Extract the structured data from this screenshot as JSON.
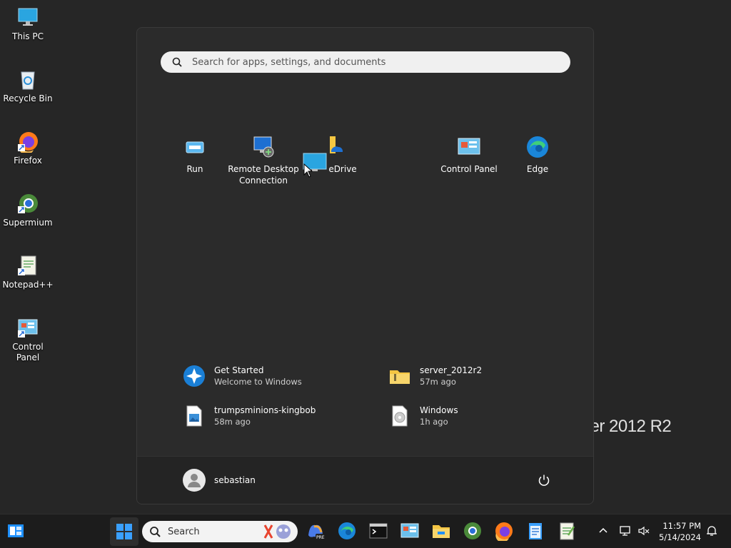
{
  "desktop": {
    "icons": [
      {
        "label": "This PC"
      },
      {
        "label": "Recycle Bin"
      },
      {
        "label": "Firefox"
      },
      {
        "label": "Supermium"
      },
      {
        "label": "Notepad++"
      },
      {
        "label": "Control Panel"
      }
    ],
    "watermark": "ver 2012 R2"
  },
  "start_menu": {
    "search": {
      "placeholder": "Search for apps, settings, and documents"
    },
    "pinned": [
      {
        "label": "Run",
        "icon": "run-icon"
      },
      {
        "label": "Remote Desktop Connection",
        "icon": "remote-desktop-icon"
      },
      {
        "label": "eDrive",
        "icon": "onedrive-icon"
      },
      {
        "label": "Control Panel",
        "icon": "control-panel-icon"
      },
      {
        "label": "Edge",
        "icon": "edge-icon"
      }
    ],
    "recommended": [
      {
        "title": "Get Started",
        "subtitle": "Welcome to Windows",
        "icon": "get-started-icon"
      },
      {
        "title": "server_2012r2",
        "subtitle": "57m ago",
        "icon": "zip-folder-icon"
      },
      {
        "title": "trumpsminions-kingbob",
        "subtitle": "58m ago",
        "icon": "image-file-icon"
      },
      {
        "title": "Windows",
        "subtitle": "1h ago",
        "icon": "disc-file-icon"
      }
    ],
    "user": {
      "name": "sebastian"
    }
  },
  "taskbar": {
    "search_label": "Search",
    "clock": {
      "time": "11:57 PM",
      "date": "5/14/2024"
    }
  },
  "colors": {
    "accent": "#1e90ff",
    "start_bg": "#2b2b2b",
    "taskbar_bg": "#1c1c1c"
  }
}
